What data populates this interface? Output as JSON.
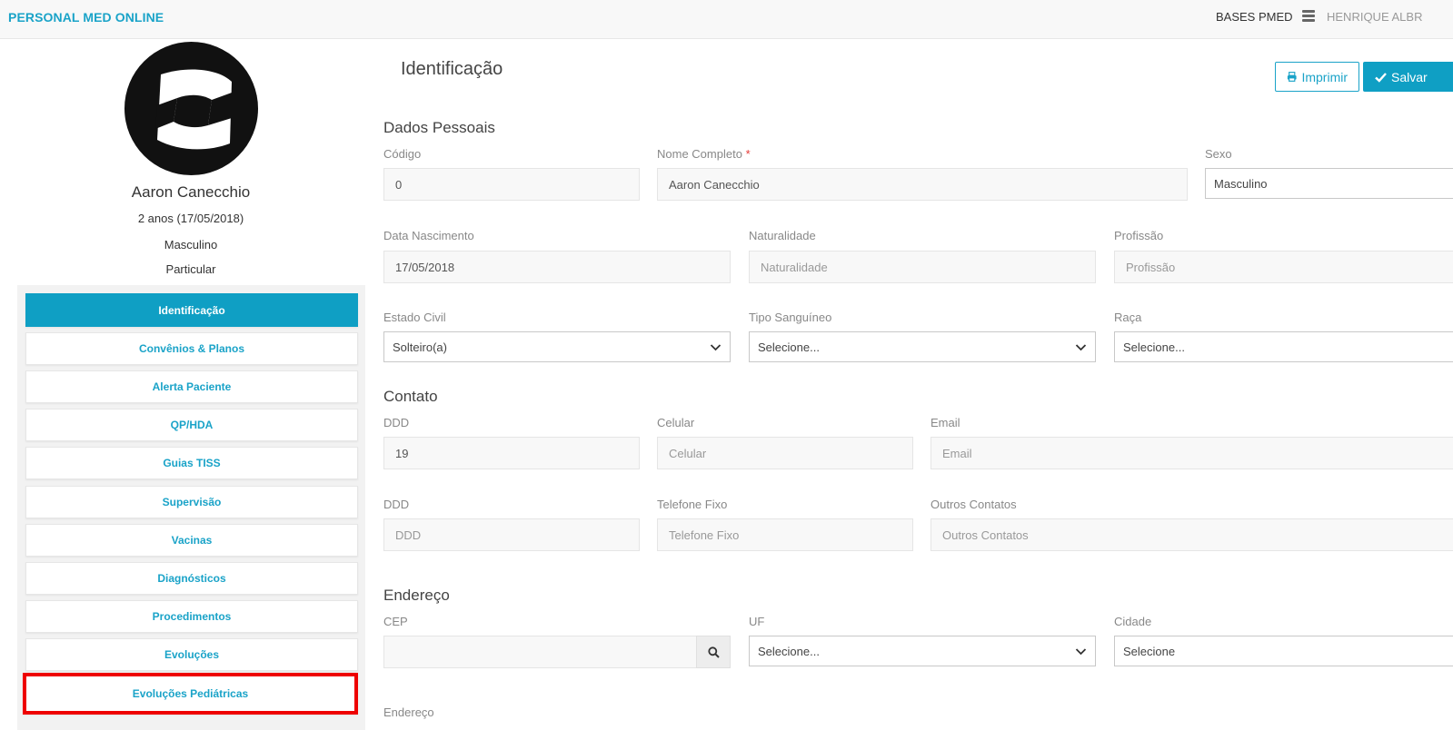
{
  "topbar": {
    "brand": "PERSONAL MED ONLINE",
    "base_label": "BASES PMED",
    "user_label": "HENRIQUE ALBR",
    "server_icon": "server-icon"
  },
  "patient": {
    "name": "Aaron Canecchio",
    "age": "2 anos (17/05/2018)",
    "sex": "Masculino",
    "plan": "Particular"
  },
  "menu": {
    "items": [
      {
        "label": "Identificação",
        "active": true
      },
      {
        "label": "Convênios & Planos"
      },
      {
        "label": "Alerta Paciente"
      },
      {
        "label": "QP/HDA"
      },
      {
        "label": "Guias TISS"
      },
      {
        "label": "Supervisão"
      },
      {
        "label": "Vacinas"
      },
      {
        "label": "Diagnósticos"
      },
      {
        "label": "Procedimentos"
      },
      {
        "label": "Evoluções"
      },
      {
        "label": "Evoluções Pediátricas",
        "highlighted": true
      }
    ]
  },
  "main": {
    "title": "Identificação",
    "print_label": "Imprimir",
    "save_label": "Salvar"
  },
  "dados_pessoais": {
    "title": "Dados Pessoais",
    "codigo": {
      "label": "Código",
      "value": "0"
    },
    "nome": {
      "label": "Nome Completo",
      "required_mark": "*",
      "value": "Aaron Canecchio"
    },
    "sexo": {
      "label": "Sexo",
      "value": "Masculino"
    },
    "nascimento": {
      "label": "Data Nascimento",
      "value": "17/05/2018"
    },
    "naturalidade": {
      "label": "Naturalidade",
      "placeholder": "Naturalidade"
    },
    "profissao": {
      "label": "Profissão",
      "placeholder": "Profissão"
    },
    "estado_civil": {
      "label": "Estado Civil",
      "value": "Solteiro(a)"
    },
    "tipo_sanguineo": {
      "label": "Tipo Sanguíneo",
      "value": "Selecione..."
    },
    "raca": {
      "label": "Raça",
      "value": "Selecione..."
    }
  },
  "contato": {
    "title": "Contato",
    "ddd1": {
      "label": "DDD",
      "value": "19"
    },
    "celular": {
      "label": "Celular",
      "placeholder": "Celular"
    },
    "email": {
      "label": "Email",
      "placeholder": "Email"
    },
    "ddd2": {
      "label": "DDD",
      "placeholder": "DDD"
    },
    "telefone": {
      "label": "Telefone Fixo",
      "placeholder": "Telefone Fixo"
    },
    "outros": {
      "label": "Outros Contatos",
      "placeholder": "Outros Contatos"
    }
  },
  "endereco": {
    "title": "Endereço",
    "cep": {
      "label": "CEP",
      "value": ""
    },
    "uf": {
      "label": "UF",
      "value": "Selecione..."
    },
    "cidade": {
      "label": "Cidade",
      "value": "Selecione"
    },
    "endereco_label": "Endereço"
  },
  "colors": {
    "accent": "#1aa3c8",
    "active_menu": "#0f9fc4",
    "highlight_border": "#ee0000"
  }
}
